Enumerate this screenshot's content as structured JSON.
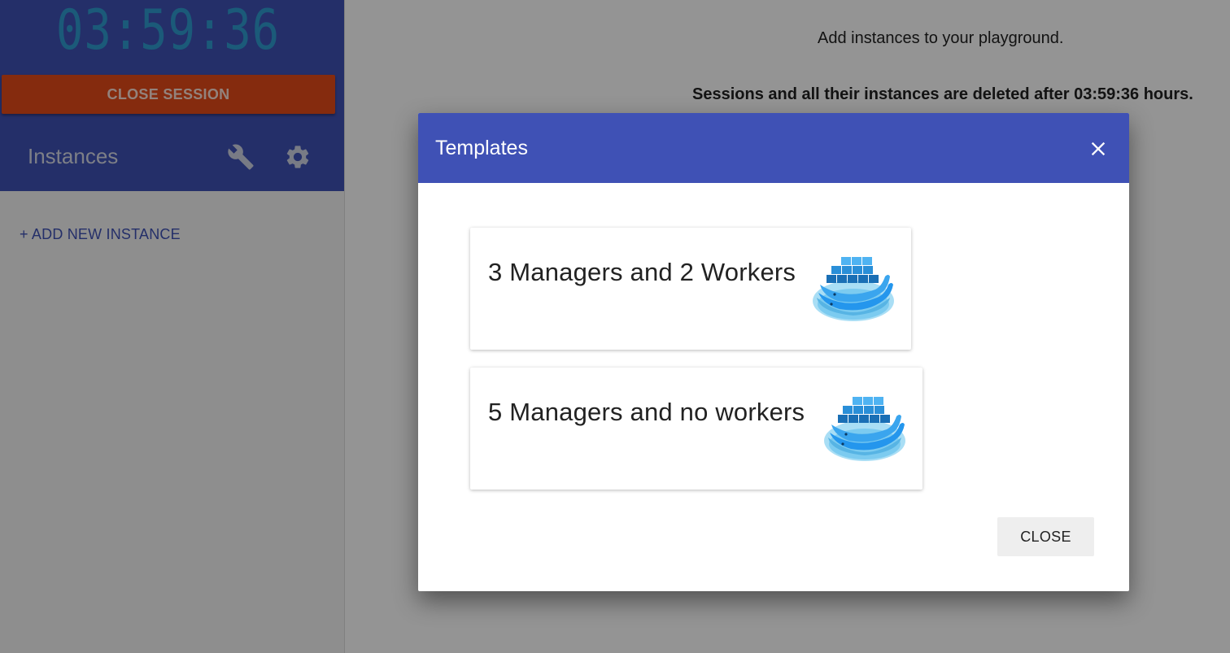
{
  "sidebar": {
    "timer": "03:59:36",
    "close_session_label": "CLOSE SESSION",
    "instances_label": "Instances",
    "add_instance_label": "+ ADD NEW INSTANCE"
  },
  "main": {
    "hint_add": "Add instances to your playground.",
    "hint_deleted": "Sessions and all their instances are deleted after 03:59:36 hours."
  },
  "dialog": {
    "title": "Templates",
    "templates": [
      {
        "label": "3 Managers and 2 Workers",
        "icon": "docker-whale-icon"
      },
      {
        "label": "5 Managers and no workers",
        "icon": "docker-whale-icon"
      }
    ],
    "close_label": "CLOSE"
  },
  "icons": {
    "wrench": "wrench-icon",
    "gear": "gear-icon",
    "close": "close-icon"
  },
  "colors": {
    "primary": "#3f51b5",
    "accent": "#e64a19",
    "timer": "#2f9bd0",
    "docker_blue": "#2496ed"
  }
}
